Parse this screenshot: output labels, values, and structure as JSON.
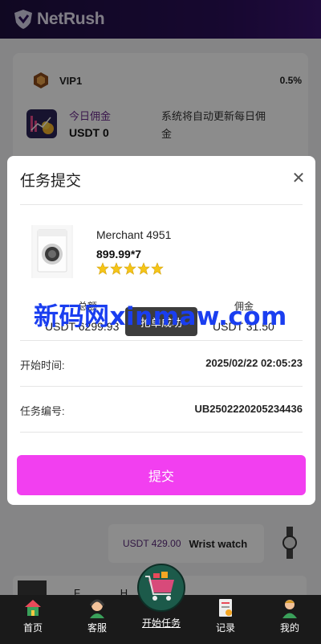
{
  "app": {
    "name": "NetRush"
  },
  "vip": {
    "level": "VIP1",
    "rate": "0.5%"
  },
  "today": {
    "label": "今日佣金",
    "value": "USDT 0",
    "note": "系统将自动更新每日佣金"
  },
  "background_products": [
    {
      "price": "USDT 429.00",
      "name": "Wrist watch"
    },
    {
      "name": "F…   …  … H…"
    }
  ],
  "modal": {
    "title": "任务提交",
    "close_icon": "close-icon",
    "product": {
      "merchant": "Merchant 4951",
      "price": "899.99*7",
      "stars": 5
    },
    "total": {
      "label": "总额",
      "value": "USDT  6299.93"
    },
    "commission": {
      "label": "佣金",
      "value": "USDT  31.50"
    },
    "toast": "抢单成功",
    "start_time": {
      "label": "开始时间:",
      "value": "2025/02/22 02:05:23"
    },
    "task_id": {
      "label": "任务编号:",
      "value": "UB2502220205234436"
    },
    "submit_label": "提交"
  },
  "watermark": "新码网xinmaw.com",
  "nav": {
    "items": [
      {
        "label": "首页",
        "icon": "home-icon"
      },
      {
        "label": "客服",
        "icon": "customer-service-icon"
      },
      {
        "label": "开始任务",
        "icon": "shopping-cart-icon"
      },
      {
        "label": "记录",
        "icon": "records-icon"
      },
      {
        "label": "我的",
        "icon": "profile-icon"
      }
    ]
  },
  "colors": {
    "header": "#2a0f58",
    "submit": "#f23ff0",
    "nav_bg": "#1a1a1a",
    "watermark": "#1a3ef0"
  }
}
